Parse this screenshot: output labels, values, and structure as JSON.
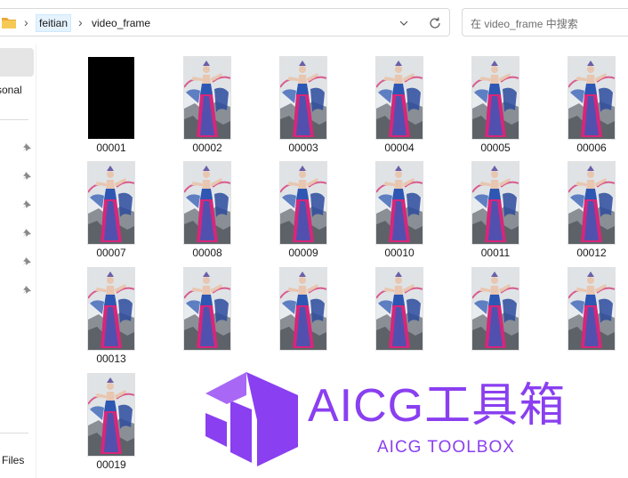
{
  "address_bar": {
    "breadcrumbs": [
      "feitian",
      "video_frame"
    ],
    "separator": "›"
  },
  "search": {
    "placeholder": "在 video_frame 中搜索"
  },
  "nav": {
    "personal_label": "sonal",
    "files_label": "Files",
    "pinned_count": 6
  },
  "files": [
    {
      "name": "00001",
      "thumb": "black"
    },
    {
      "name": "00002",
      "thumb": "dancer"
    },
    {
      "name": "00003",
      "thumb": "dancer"
    },
    {
      "name": "00004",
      "thumb": "dancer"
    },
    {
      "name": "00005",
      "thumb": "dancer"
    },
    {
      "name": "00006",
      "thumb": "dancer"
    },
    {
      "name": "00007",
      "thumb": "dancer"
    },
    {
      "name": "00008",
      "thumb": "dancer"
    },
    {
      "name": "00009",
      "thumb": "dancer"
    },
    {
      "name": "00010",
      "thumb": "dancer"
    },
    {
      "name": "00011",
      "thumb": "dancer"
    },
    {
      "name": "00012",
      "thumb": "dancer"
    },
    {
      "name": "00013",
      "thumb": "dancer"
    },
    {
      "name": "",
      "thumb": "dancer"
    },
    {
      "name": "",
      "thumb": "dancer"
    },
    {
      "name": "",
      "thumb": "dancer"
    },
    {
      "name": "",
      "thumb": "dancer"
    },
    {
      "name": "",
      "thumb": "dancer"
    },
    {
      "name": "00019",
      "thumb": "dancer"
    }
  ],
  "watermark": {
    "title": "AICG工具箱",
    "subtitle": "AICG TOOLBOX",
    "color": "#8a3ff0"
  },
  "colors": {
    "selection": "#e5f3ff",
    "folder": "#f4c44c"
  }
}
